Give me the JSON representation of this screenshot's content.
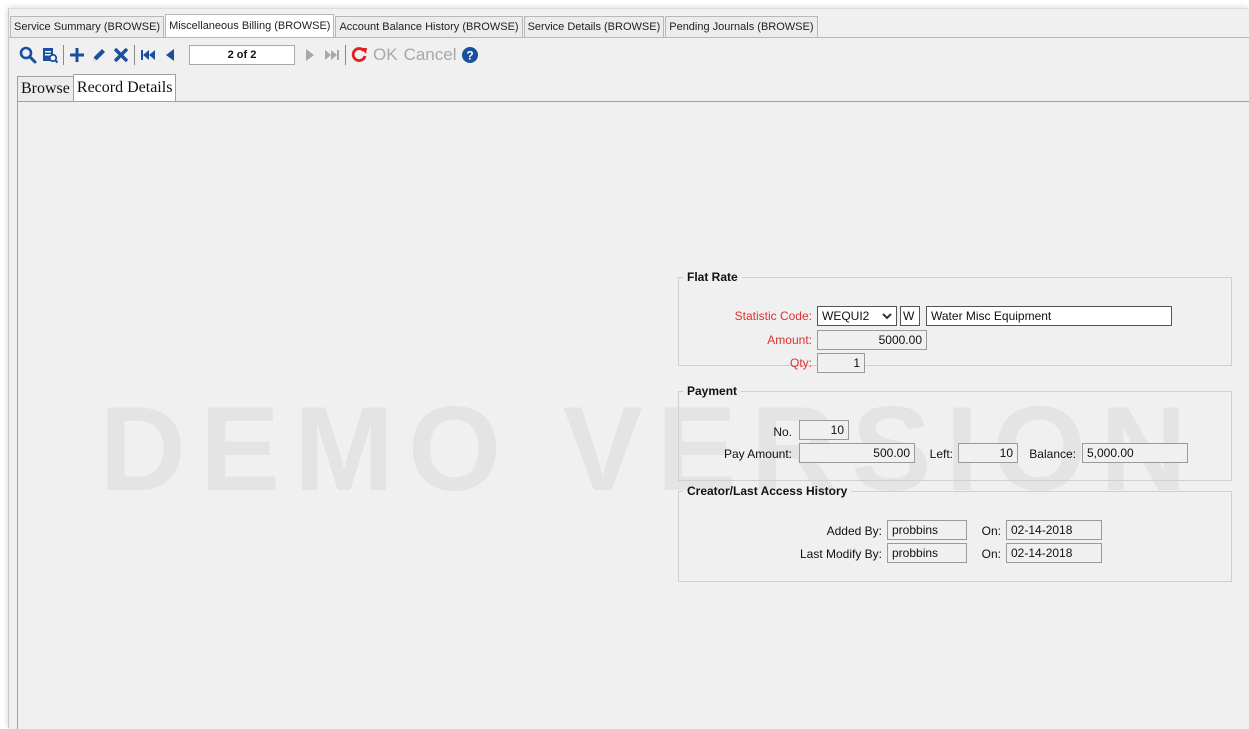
{
  "top_tabs": [
    {
      "label": "Service Summary (BROWSE)",
      "active": false
    },
    {
      "label": "Miscellaneous Billing (BROWSE)",
      "active": true
    },
    {
      "label": "Account Balance History (BROWSE)",
      "active": false
    },
    {
      "label": "Service Details (BROWSE)",
      "active": false
    },
    {
      "label": "Pending Journals (BROWSE)",
      "active": false
    }
  ],
  "toolbar": {
    "record_position": "2 of 2",
    "ok_label": "OK",
    "cancel_label": "Cancel",
    "icons": [
      "search-icon",
      "report-icon",
      "add-icon",
      "edit-icon",
      "delete-icon",
      "first-record-icon",
      "previous-record-icon",
      "next-record-icon",
      "last-record-icon",
      "refresh-icon",
      "help-icon"
    ],
    "accent_blue": "#1a4fa0",
    "refresh_red": "#e02020",
    "disabled_gray": "#a8a8a8"
  },
  "sub_tabs": [
    {
      "label": "Browse",
      "active": false
    },
    {
      "label": "Record Details",
      "active": true
    }
  ],
  "watermark": "DEMO VERSION",
  "flat_rate": {
    "title": "Flat Rate",
    "statistic_code_label": "Statistic Code:",
    "statistic_code_value": "WEQUI2",
    "statistic_type": "W",
    "statistic_description": "Water Misc Equipment",
    "amount_label": "Amount:",
    "amount_value": "5000.00",
    "qty_label": "Qty:",
    "qty_value": "1",
    "required_label_color": "#e03030"
  },
  "payment": {
    "title": "Payment",
    "no_label": "No.",
    "no_value": "10",
    "pay_amount_label": "Pay Amount:",
    "pay_amount_value": "500.00",
    "left_label": "Left:",
    "left_value": "10",
    "balance_label": "Balance:",
    "balance_value": "5,000.00"
  },
  "history": {
    "title": "Creator/Last Access History",
    "added_by_label": "Added By:",
    "added_by_value": "probbins",
    "added_on_label": "On:",
    "added_on_value": "02-14-2018",
    "modified_by_label": "Last Modify By:",
    "modified_by_value": "probbins",
    "modified_on_label": "On:",
    "modified_on_value": "02-14-2018"
  }
}
